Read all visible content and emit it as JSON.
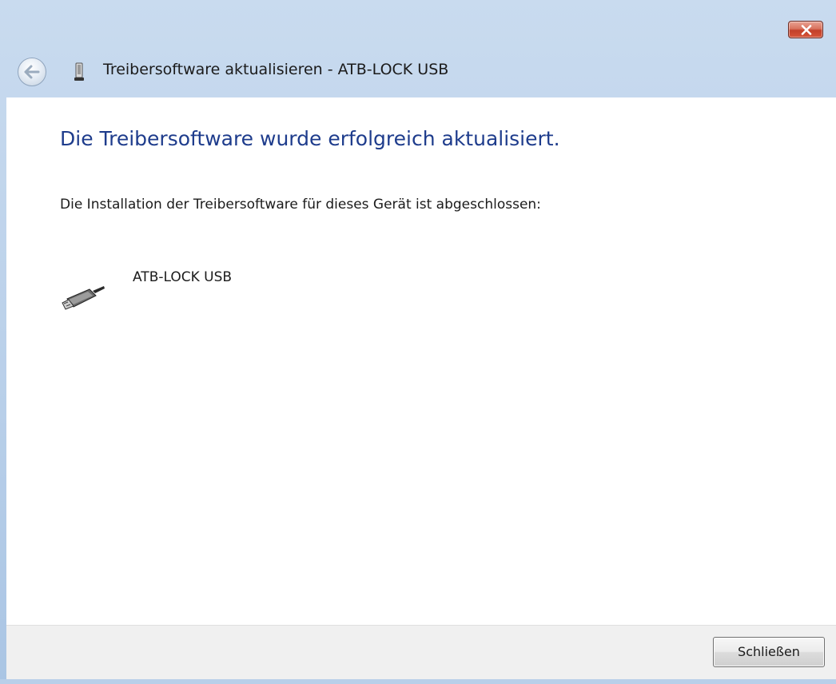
{
  "window": {
    "title": "Treibersoftware aktualisieren - ATB-LOCK USB",
    "close_icon": "close-icon",
    "back_icon": "back-arrow-icon",
    "title_icon": "usb-device-icon"
  },
  "content": {
    "heading": "Die Treibersoftware wurde erfolgreich aktualisiert.",
    "description": "Die Installation der Treibersoftware für dieses Gerät ist abgeschlossen:",
    "device": {
      "name": "ATB-LOCK USB",
      "icon": "usb-plug-icon"
    }
  },
  "footer": {
    "close_label": "Schließen"
  },
  "colors": {
    "heading": "#1e3c8c",
    "titlebar": "#b8cfe9",
    "close_button": "#c2402a",
    "footer_bg": "#f0f0f0"
  }
}
